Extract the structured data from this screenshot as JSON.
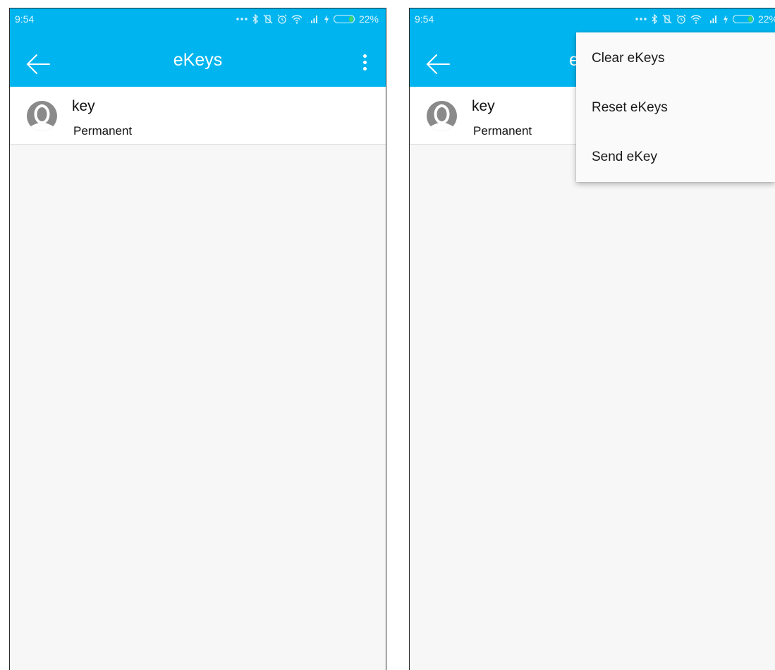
{
  "left_screen": {
    "status_bar": {
      "time": "9:54",
      "icons": [
        "more-dots-icon",
        "bluetooth-icon",
        "vibrate-off-icon",
        "alarm-icon",
        "wifi-icon",
        "signal-icon",
        "charging-icon",
        "battery-icon"
      ],
      "battery": "22%"
    },
    "toolbar": {
      "back_icon": "arrow-left-icon",
      "title": "eKeys",
      "overflow_icon": "more-vert-icon"
    },
    "list": [
      {
        "name": "key",
        "type": "Permanent",
        "avatar_icon": "person-avatar-icon"
      }
    ]
  },
  "right_screen": {
    "status_bar": {
      "time": "9:54",
      "battery": "22%"
    },
    "toolbar": {
      "title_fragment": "e"
    },
    "list": [
      {
        "name": "key",
        "type": "Permanent",
        "avatar_icon": "person-avatar-icon"
      }
    ],
    "overflow_menu": {
      "items": [
        "Clear eKeys",
        "Reset eKeys",
        "Send eKey"
      ]
    }
  },
  "colors": {
    "toolbar": "#00b5ef",
    "background": "#f7f7f7",
    "battery_fill": "#40d86a"
  }
}
